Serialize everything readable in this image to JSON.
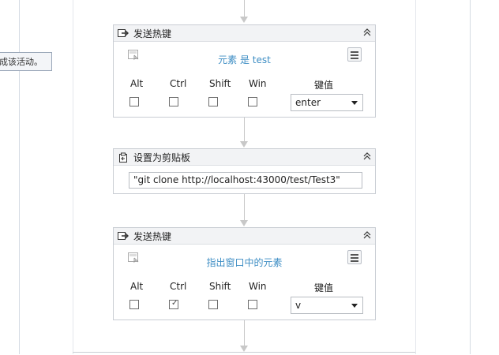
{
  "tooltip_text": "成该活动。",
  "activities": [
    {
      "title": "发送热键",
      "target": "元素 是 test",
      "keys": [
        {
          "label": "Alt",
          "checked": false
        },
        {
          "label": "Ctrl",
          "checked": false
        },
        {
          "label": "Shift",
          "checked": false
        },
        {
          "label": "Win",
          "checked": false
        }
      ],
      "key_value_label": "键值",
      "key_value": "enter"
    },
    {
      "title": "设置为剪贴板",
      "text_value": "\"git clone http://localhost:43000/test/Test3\""
    },
    {
      "title": "发送热键",
      "target": "指出窗口中的元素",
      "keys": [
        {
          "label": "Alt",
          "checked": false
        },
        {
          "label": "Ctrl",
          "checked": true
        },
        {
          "label": "Shift",
          "checked": false
        },
        {
          "label": "Win",
          "checked": false
        }
      ],
      "key_value_label": "键值",
      "key_value": "v"
    }
  ],
  "icons": {
    "activity_header": "send-hotkey-icon",
    "clipboard_header": "clipboard-icon",
    "target": "target-element-icon",
    "collapse": "collapse-chevron-icon",
    "menu": "menu-icon"
  },
  "colors": {
    "target_link": "#3e8ec4",
    "header_bg": "#f2f3f5",
    "connector": "#c8c8c8"
  }
}
